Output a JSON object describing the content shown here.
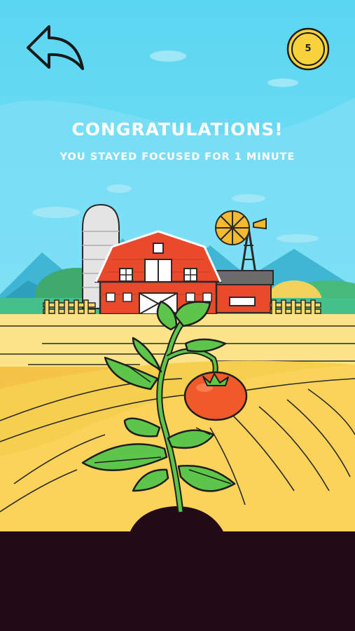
{
  "header": {
    "back_icon": "back-arrow-icon",
    "coin_icon": "coin-icon",
    "coin_count": "5"
  },
  "message": {
    "title": "CONGRATULATIONS!",
    "subtitle": "YOU STAYED FOCUSED FOR 1 MINUTE"
  },
  "scene": {
    "barn_icon": "barn-icon",
    "silo_icon": "silo-icon",
    "windmill_icon": "windmill-icon",
    "plant_icon": "tomato-plant-icon",
    "tomato_icon": "tomato-icon"
  },
  "colors": {
    "sky": "#55d4f0",
    "barn_red": "#e94a2c",
    "field_yellow": "#f5c346",
    "field_light": "#fbe38a",
    "leaf_green": "#5cc54a",
    "tomato": "#f0592a",
    "soil": "#220a17",
    "coin": "#f7d23a"
  }
}
